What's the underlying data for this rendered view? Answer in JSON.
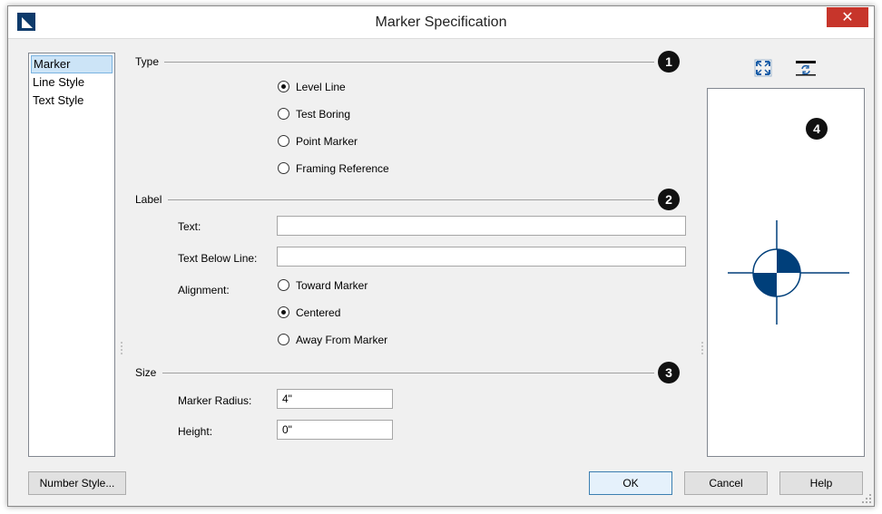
{
  "window": {
    "title": "Marker Specification",
    "close_glyph": "✕"
  },
  "sidebar": {
    "items": [
      {
        "label": "Marker",
        "selected": true
      },
      {
        "label": "Line Style"
      },
      {
        "label": "Text Style"
      }
    ]
  },
  "type_section": {
    "label": "Type",
    "badge": "1",
    "options": [
      {
        "label": "Level Line",
        "checked": true
      },
      {
        "label": "Test Boring",
        "checked": false
      },
      {
        "label": "Point Marker",
        "checked": false
      },
      {
        "label": "Framing Reference",
        "checked": false
      }
    ]
  },
  "label_section": {
    "label": "Label",
    "badge": "2",
    "text_label": "Text:",
    "text_value": "",
    "below_label": "Text Below Line:",
    "below_value": "",
    "alignment_label": "Alignment:",
    "alignment_options": [
      {
        "label": "Toward Marker",
        "checked": false
      },
      {
        "label": "Centered",
        "checked": true
      },
      {
        "label": "Away From Marker",
        "checked": false
      }
    ]
  },
  "size_section": {
    "label": "Size",
    "badge": "3",
    "radius_label": "Marker Radius:",
    "radius_value": "4\"",
    "height_label": "Height:",
    "height_value": "0\""
  },
  "preview": {
    "badge": "4",
    "icons": [
      "fit-view-icon",
      "swap-icon"
    ]
  },
  "buttons": {
    "number_style": "Number Style...",
    "ok": "OK",
    "cancel": "Cancel",
    "help": "Help"
  },
  "colors": {
    "accent": "#0d3a6b",
    "close": "#c7352b",
    "marker_fill": "#003f7a"
  }
}
